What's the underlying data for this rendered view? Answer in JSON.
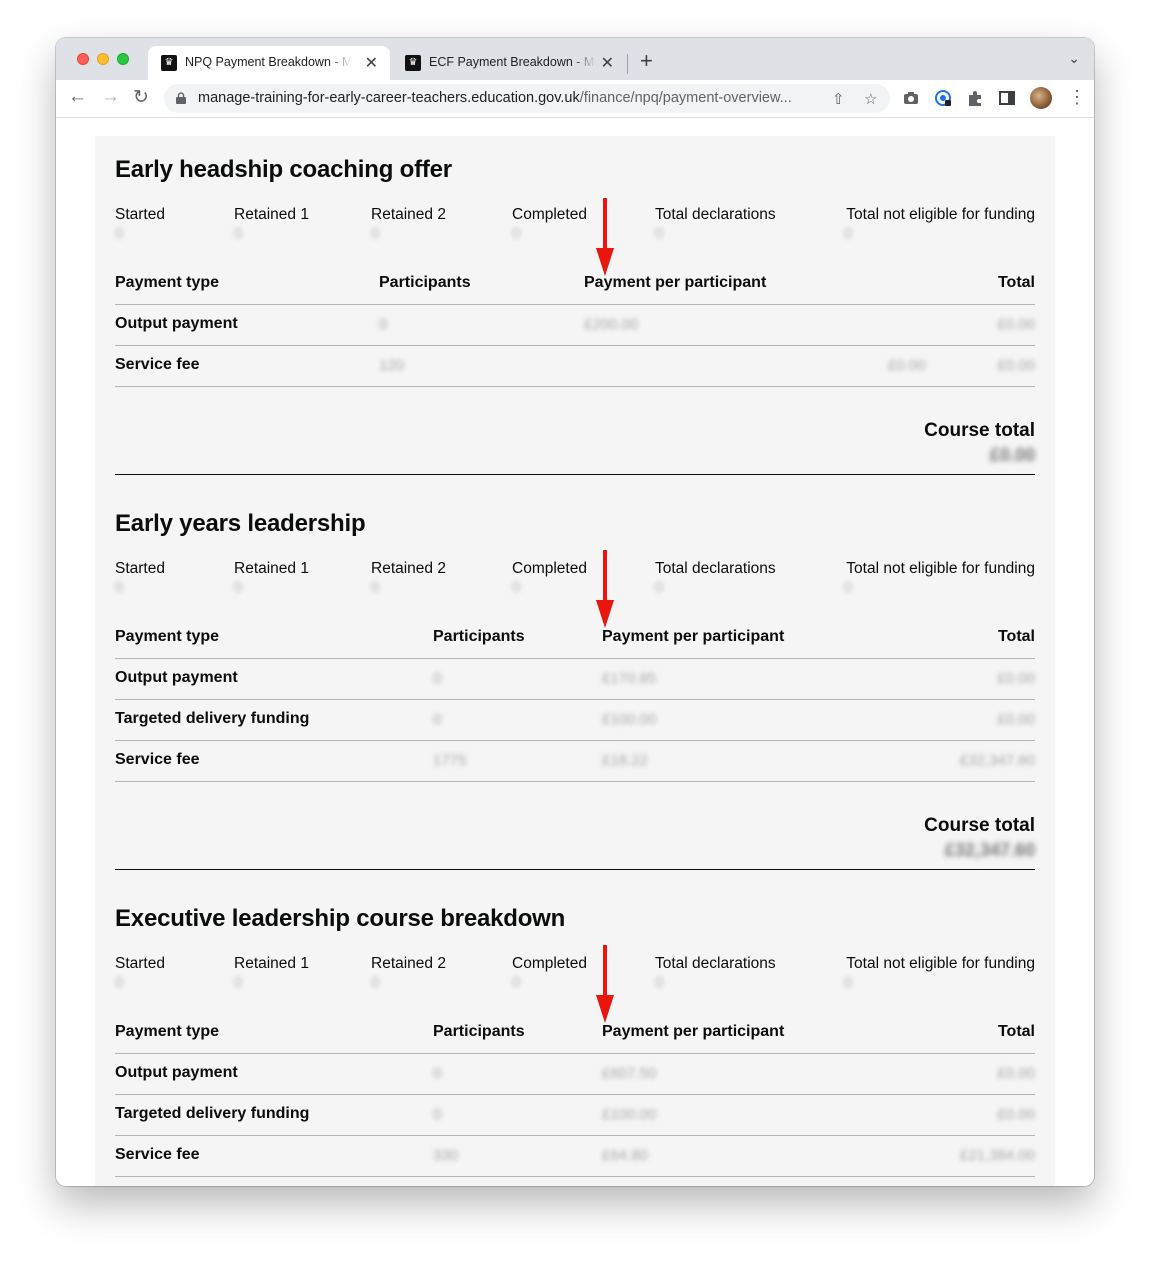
{
  "browser": {
    "tabs": [
      {
        "title": "NPQ Payment Breakdown - Ma",
        "active": true
      },
      {
        "title": "ECF Payment Breakdown - Ma",
        "active": false
      }
    ],
    "url": {
      "domain": "manage-training-for-early-career-teachers.education.gov.uk",
      "path": "/finance/npq/payment-overview..."
    },
    "icons": {
      "back": "back-arrow-icon",
      "forward": "forward-arrow-icon",
      "reload": "reload-icon",
      "share": "share-icon",
      "bookmark": "star-icon",
      "camera": "camera-icon",
      "extension": "puzzle-icon",
      "sidepanel": "side-panel-icon",
      "menu": "kebab-menu-icon"
    },
    "glyphs": {
      "close": "✕",
      "new_tab": "+",
      "tab_menu": "⌄",
      "back": "←",
      "forward": "→",
      "reload": "↻",
      "share": "⇧",
      "star": "☆",
      "kebab": "⋮",
      "favicon": "♛"
    }
  },
  "stat_labels": [
    "Started",
    "Retained 1",
    "Retained 2",
    "Completed",
    "Total declarations",
    "Total not eligible for funding"
  ],
  "table_headers": {
    "payment_type": "Payment type",
    "participants": "Participants",
    "payment_per_participant": "Payment per participant",
    "total": "Total"
  },
  "course_total_label": "Course total",
  "annotation_color": "#e8160c",
  "sections": [
    {
      "title": "Early headship coaching offer",
      "stats": [
        "0",
        "0",
        "0",
        "0",
        "0",
        "0"
      ],
      "rows": [
        {
          "type": "Output payment",
          "participants": "0",
          "per_participant": "£200.00",
          "extra": "",
          "total": "£0.00"
        },
        {
          "type": "Service fee",
          "participants": "120",
          "per_participant": "",
          "extra": "£0.00",
          "total": "£0.00"
        }
      ],
      "course_total": "£0.00"
    },
    {
      "title": "Early years leadership",
      "stats": [
        "0",
        "0",
        "0",
        "0",
        "0",
        "0"
      ],
      "rows": [
        {
          "type": "Output payment",
          "participants": "0",
          "per_participant": "£170.85",
          "total": "£0.00"
        },
        {
          "type": "Targeted delivery funding",
          "participants": "0",
          "per_participant": "£100.00",
          "total": "£0.00"
        },
        {
          "type": "Service fee",
          "participants": "1775",
          "per_participant": "£18.22",
          "total": "£32,347.60"
        }
      ],
      "course_total": "£32,347.60"
    },
    {
      "title": "Executive leadership course breakdown",
      "stats": [
        "0",
        "0",
        "0",
        "0",
        "0",
        "0"
      ],
      "rows": [
        {
          "type": "Output payment",
          "participants": "0",
          "per_participant": "£607.50",
          "total": "£0.00"
        },
        {
          "type": "Targeted delivery funding",
          "participants": "0",
          "per_participant": "£100.00",
          "total": "£0.00"
        },
        {
          "type": "Service fee",
          "participants": "330",
          "per_participant": "£64.80",
          "total": "£21,384.00"
        }
      ]
    }
  ]
}
